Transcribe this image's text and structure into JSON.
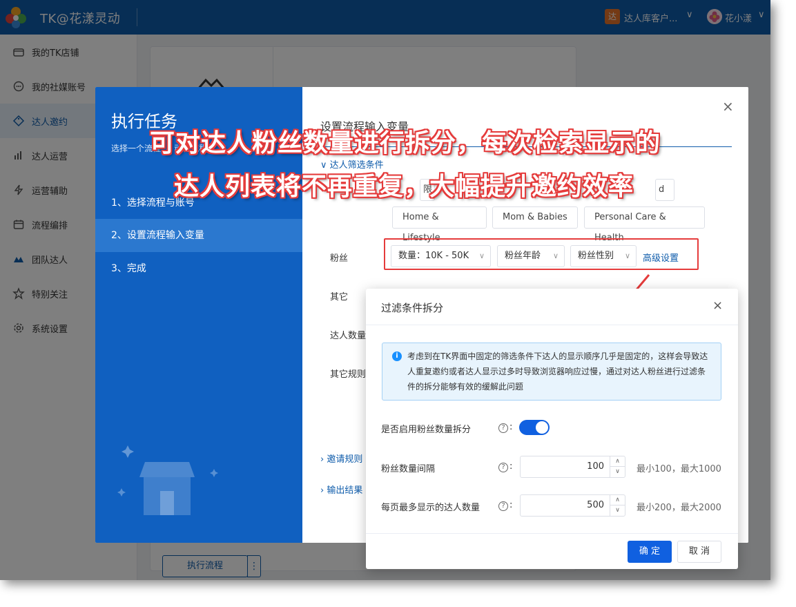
{
  "topbar": {
    "app_title": "TK@花漾灵动",
    "store_badge": "达",
    "store_name": "达人库客户...",
    "user_name": "花小漾",
    "chevron": "∨"
  },
  "sidebar": {
    "items": [
      {
        "label": "我的TK店铺",
        "icon": "store-icon"
      },
      {
        "label": "我的社媒账号",
        "icon": "chat-icon"
      },
      {
        "label": "达人邀约",
        "icon": "tag-icon"
      },
      {
        "label": "达人运营",
        "icon": "chart-icon"
      },
      {
        "label": "运营辅助",
        "icon": "lightning-icon"
      },
      {
        "label": "流程编排",
        "icon": "calendar-icon"
      },
      {
        "label": "团队达人",
        "icon": "team-icon"
      },
      {
        "label": "特别关注",
        "icon": "star-icon"
      },
      {
        "label": "系统设置",
        "icon": "gear-icon"
      }
    ],
    "active_index": 2
  },
  "main": {
    "run_flow_label": "执行流程",
    "run_more_label": "⋮"
  },
  "task_dialog": {
    "title": "执行任务",
    "subtitle": "选择一个流程 ... 动化流程",
    "steps": [
      "1、选择流程与账号",
      "2、设置流程输入变量",
      "3、完成"
    ],
    "active_step": 1,
    "close": "×",
    "section_title": "设置流程输入变量",
    "filter_toggle": "∨ 达人筛选条件",
    "chips_row1": [
      "限",
      "d"
    ],
    "chips_row2": [
      "Home & Lifestyle",
      "Mom & Babies",
      "Personal Care & Health"
    ],
    "fans_label": "粉丝",
    "fans_count": "数量：10K - 50K",
    "fans_age": "粉丝年龄",
    "fans_gender": "粉丝性别",
    "advanced": "高级设置",
    "other_label": "其它",
    "talent_count_label": "达人数量",
    "other_rules_label": "其它规则",
    "invite_rules": "› 邀请规则",
    "output_result": "› 输出结果"
  },
  "headline": {
    "line1": "可对达人粉丝数量进行拆分，每次检索显示的",
    "line2": "达人列表将不再重复，大幅提升邀约效率"
  },
  "split_dialog": {
    "title": "过滤条件拆分",
    "close": "×",
    "info": "考虑到在TK界面中固定的筛选条件下达人的显示顺序几乎是固定的，这样会导致达人重复邀约或者达人显示过多时导致浏览器响应过慢，通过对达人粉丝进行过滤条件的拆分能够有效的缓解此问题",
    "enable_label": "是否启用粉丝数量拆分",
    "enable_on": true,
    "interval_label": "粉丝数量间隔",
    "interval_value": "100",
    "interval_hint": "最小100，最大1000",
    "page_max_label": "每页最多显示的达人数量",
    "page_max_value": "500",
    "page_max_hint": "最小200，最大2000",
    "help": "?",
    "colon": ":",
    "confirm": "确 定",
    "cancel": "取 消"
  },
  "colors": {
    "topbar": "#0f5cab",
    "task_left": "#1060c0",
    "primary": "#1060e0",
    "annotation_red": "#e53b3b"
  }
}
